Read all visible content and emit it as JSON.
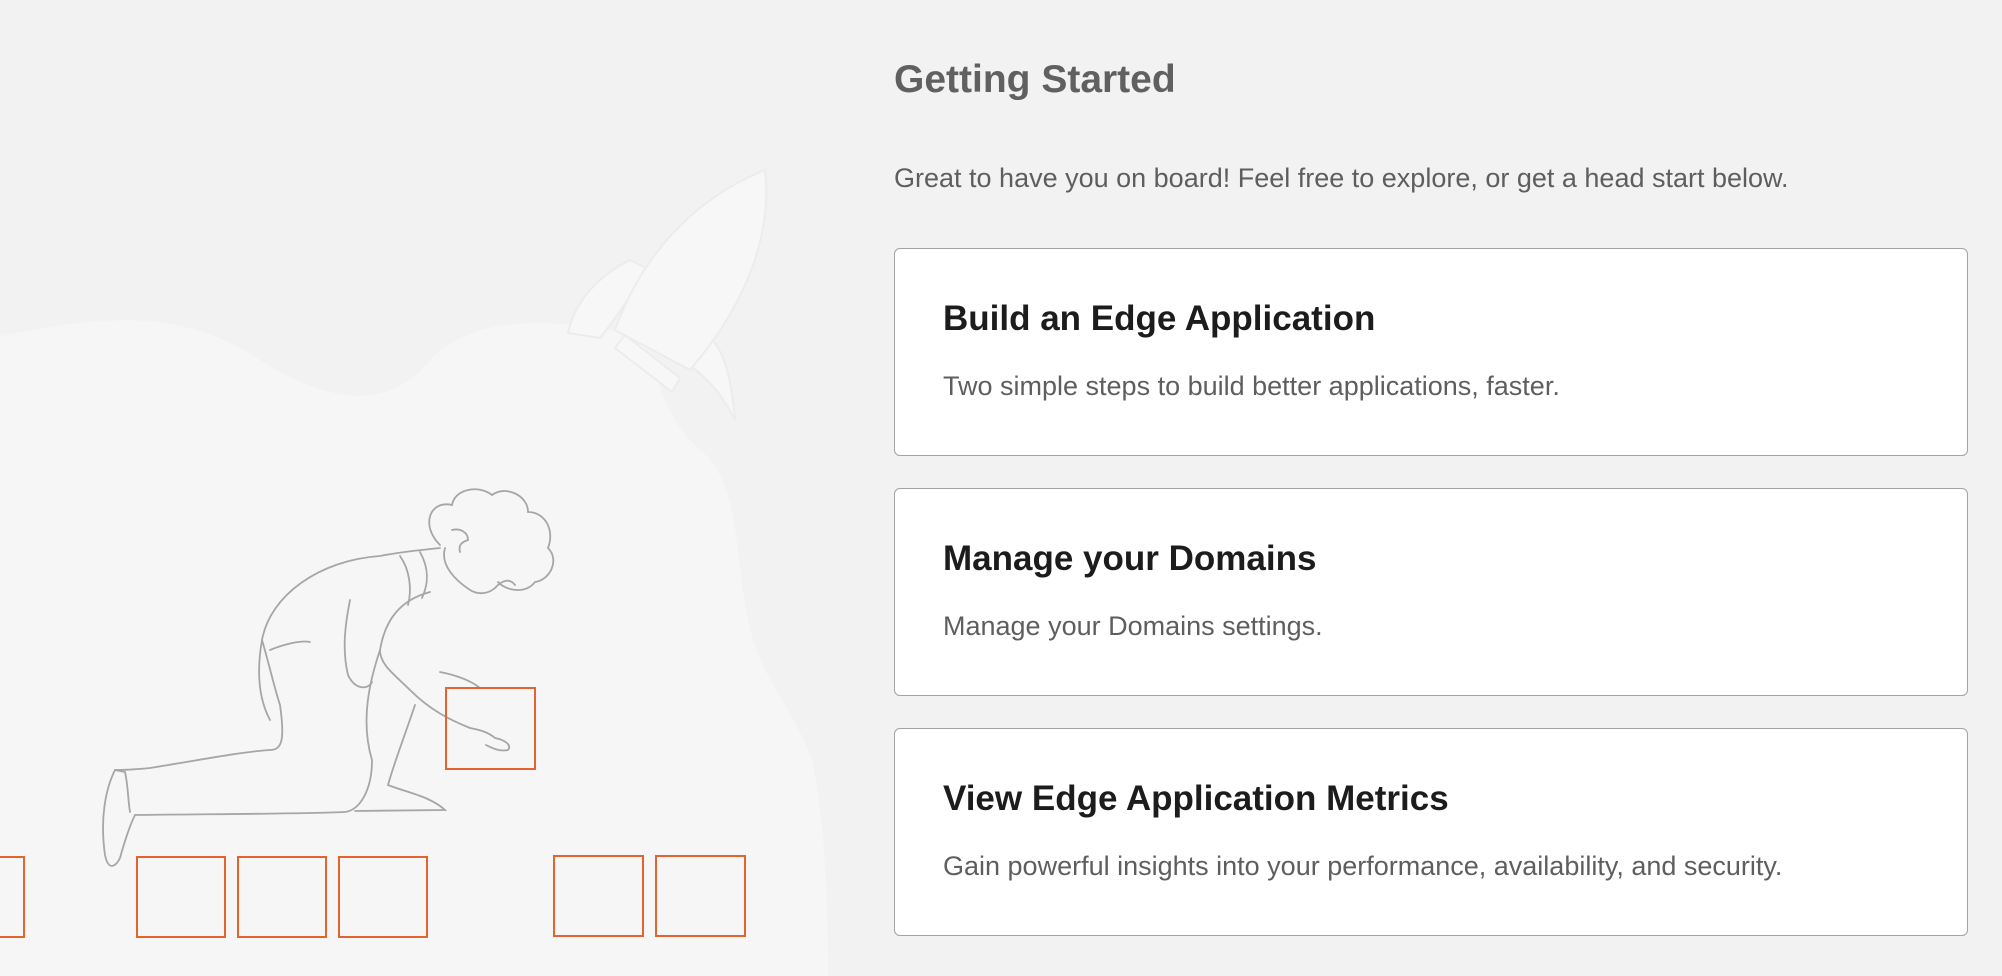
{
  "header": {
    "title": "Getting Started",
    "subtitle": "Great to have you on board! Feel free to explore, or get a head start below."
  },
  "cards": [
    {
      "title": "Build an Edge Application",
      "description": "Two simple steps to build better applications, faster."
    },
    {
      "title": "Manage your Domains",
      "description": "Manage your Domains settings."
    },
    {
      "title": "View Edge Application Metrics",
      "description": "Gain powerful insights into your performance, availability, and security."
    }
  ],
  "illustration": {
    "icon": "person-building-blocks-with-rocket",
    "accent_color": "#e2652f"
  },
  "colors": {
    "background": "#f2f2f2",
    "card_background": "#ffffff",
    "card_border": "#a3a3a3",
    "title_text": "#606060",
    "card_title_text": "#1c1c1c",
    "body_text": "#5e5e5e"
  }
}
